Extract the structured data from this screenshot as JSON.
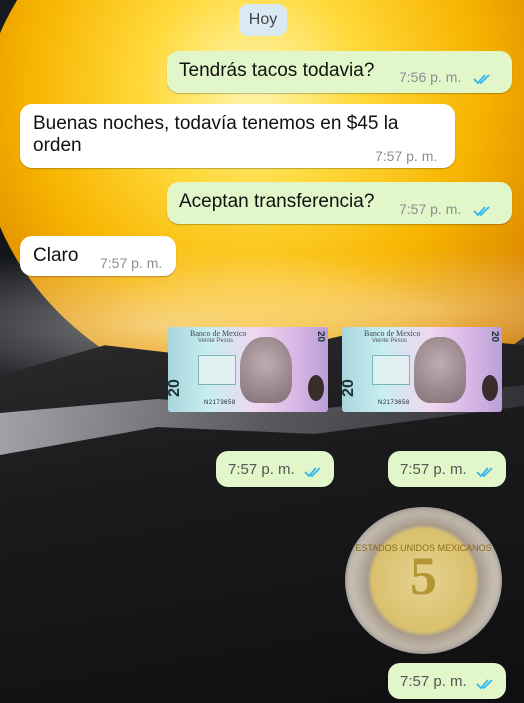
{
  "day_separator": "Hoy",
  "colors": {
    "outgoing_bubble": "#e1f6c9",
    "incoming_bubble": "#ffffff",
    "read_ticks": "#34b7f1",
    "timestamp": "#8a8f93"
  },
  "messages": [
    {
      "direction": "out",
      "text": "Tendrás tacos todavia?",
      "time": "7:56 p. m.",
      "status": "read"
    },
    {
      "direction": "in",
      "text": "Buenas noches, todavía tenemos en $45 la orden",
      "time": "7:57 p. m."
    },
    {
      "direction": "out",
      "text": "Aceptan transferencia?",
      "time": "7:57 p. m.",
      "status": "read"
    },
    {
      "direction": "in",
      "text": "Claro",
      "time": "7:57 p. m."
    },
    {
      "direction": "out",
      "type": "image",
      "time": "7:57 p. m.",
      "status": "read",
      "image": {
        "bank": "Banco de Mexico",
        "denomination_text": "Veinte Pesos",
        "value": "20",
        "serial": "N2173658"
      }
    },
    {
      "direction": "out",
      "type": "image",
      "time": "7:57 p. m.",
      "status": "read",
      "image": {
        "bank": "Banco de Mexico",
        "denomination_text": "Veinte Pesos",
        "value": "20",
        "serial": "N2173658"
      }
    },
    {
      "direction": "out",
      "type": "image",
      "time": "7:57 p. m.",
      "status": "read",
      "image": {
        "coin_value": "5",
        "coin_caption": "ESTADOS UNIDOS MEXICANOS"
      }
    }
  ],
  "icons": {
    "read_status": "double-check-icon"
  }
}
